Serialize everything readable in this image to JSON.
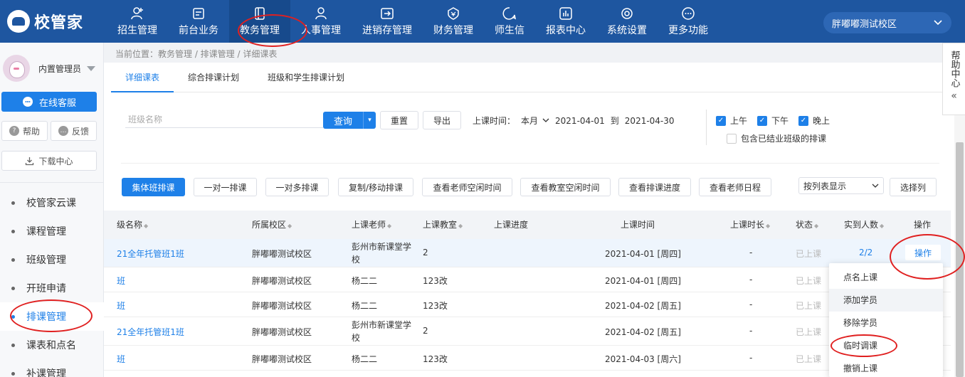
{
  "app": {
    "logo_text": "校管家"
  },
  "nav": [
    {
      "label": "招生管理",
      "icon": "user-add-icon"
    },
    {
      "label": "前台业务",
      "icon": "frontdesk-icon"
    },
    {
      "label": "教务管理",
      "icon": "book-icon",
      "active": true
    },
    {
      "label": "人事管理",
      "icon": "person-icon"
    },
    {
      "label": "进销存管理",
      "icon": "inventory-icon"
    },
    {
      "label": "财务管理",
      "icon": "finance-icon"
    },
    {
      "label": "师生信",
      "icon": "chat-icon"
    },
    {
      "label": "报表中心",
      "icon": "report-icon"
    },
    {
      "label": "系统设置",
      "icon": "settings-icon"
    },
    {
      "label": "更多功能",
      "icon": "more-icon"
    }
  ],
  "campus": "胖嘟嘟测试校区",
  "sidebar": {
    "user_name": "内置管理员",
    "online_service": "在线客服",
    "help": "帮助",
    "feedback": "反馈",
    "download": "下载中心",
    "items": [
      {
        "label": "校管家云课"
      },
      {
        "label": "课程管理"
      },
      {
        "label": "班级管理"
      },
      {
        "label": "开班申请"
      },
      {
        "label": "排课管理",
        "active": true
      },
      {
        "label": "课表和点名"
      },
      {
        "label": "补课管理"
      }
    ]
  },
  "breadcrumb": "当前位置：教务管理 / 排课管理 / 详细课表",
  "tabs": [
    {
      "label": "详细课表",
      "active": true
    },
    {
      "label": "综合排课计划"
    },
    {
      "label": "班级和学生排课计划"
    }
  ],
  "filters": {
    "class_name_placeholder": "班级名称",
    "query": "查询",
    "reset": "重置",
    "export": "导出",
    "time_label": "上课时间：",
    "period": "本月",
    "date_from": "2021-04-01",
    "to": "到",
    "date_to": "2021-04-30",
    "morning": "上午",
    "afternoon": "下午",
    "evening": "晚上",
    "include_finished": "包含已结业班级的排课"
  },
  "actions": {
    "group_schedule": "集体班排课",
    "one_on_one": "一对一排课",
    "one_to_many": "一对多排课",
    "copy_move": "复制/移动排课",
    "teacher_free": "查看老师空闲时间",
    "room_free": "查看教室空闲时间",
    "progress": "查看排课进度",
    "teacher_schedule": "查看老师日程",
    "view_mode": "按列表显示",
    "select_columns": "选择列"
  },
  "table": {
    "headers": [
      "级名称",
      "所属校区",
      "上课老师",
      "上课教室",
      "上课进度",
      "上课时间",
      "上课时长",
      "状态",
      "实到人数",
      "操作"
    ],
    "rows": [
      {
        "name": "21全年托管班1班",
        "campus": "胖嘟嘟测试校区",
        "teacher": "彭州市新课堂学校",
        "room": "2",
        "time": "2021-04-01 [周四]",
        "duration": "-",
        "status": "已上课",
        "attendance": "2/2"
      },
      {
        "name": "班",
        "campus": "胖嘟嘟测试校区",
        "teacher": "杨二二",
        "room": "123改",
        "time": "2021-04-01 [周四]",
        "duration": "-",
        "status": "已上课",
        "attendance": ""
      },
      {
        "name": "班",
        "campus": "胖嘟嘟测试校区",
        "teacher": "杨二二",
        "room": "123改",
        "time": "2021-04-02 [周五]",
        "duration": "-",
        "status": "已上课",
        "attendance": ""
      },
      {
        "name": "21全年托管班1班",
        "campus": "胖嘟嘟测试校区",
        "teacher": "彭州市新课堂学校",
        "room": "2",
        "time": "2021-04-02 [周五]",
        "duration": "-",
        "status": "已上课",
        "attendance": ""
      },
      {
        "name": "班",
        "campus": "胖嘟嘟测试校区",
        "teacher": "杨二二",
        "room": "123改",
        "time": "2021-04-03 [周六]",
        "duration": "-",
        "status": "已上课",
        "attendance": ""
      }
    ],
    "operate_label": "操作"
  },
  "dropdown": [
    {
      "label": "点名上课"
    },
    {
      "label": "添加学员",
      "hover": true
    },
    {
      "label": "移除学员"
    },
    {
      "label": "临时调课"
    },
    {
      "label": "撤销上课"
    }
  ],
  "help_tab": {
    "text": "帮助中心"
  },
  "colors": {
    "brand": "#1e56a0",
    "primary": "#1e80e8",
    "annotation": "#e02020"
  }
}
